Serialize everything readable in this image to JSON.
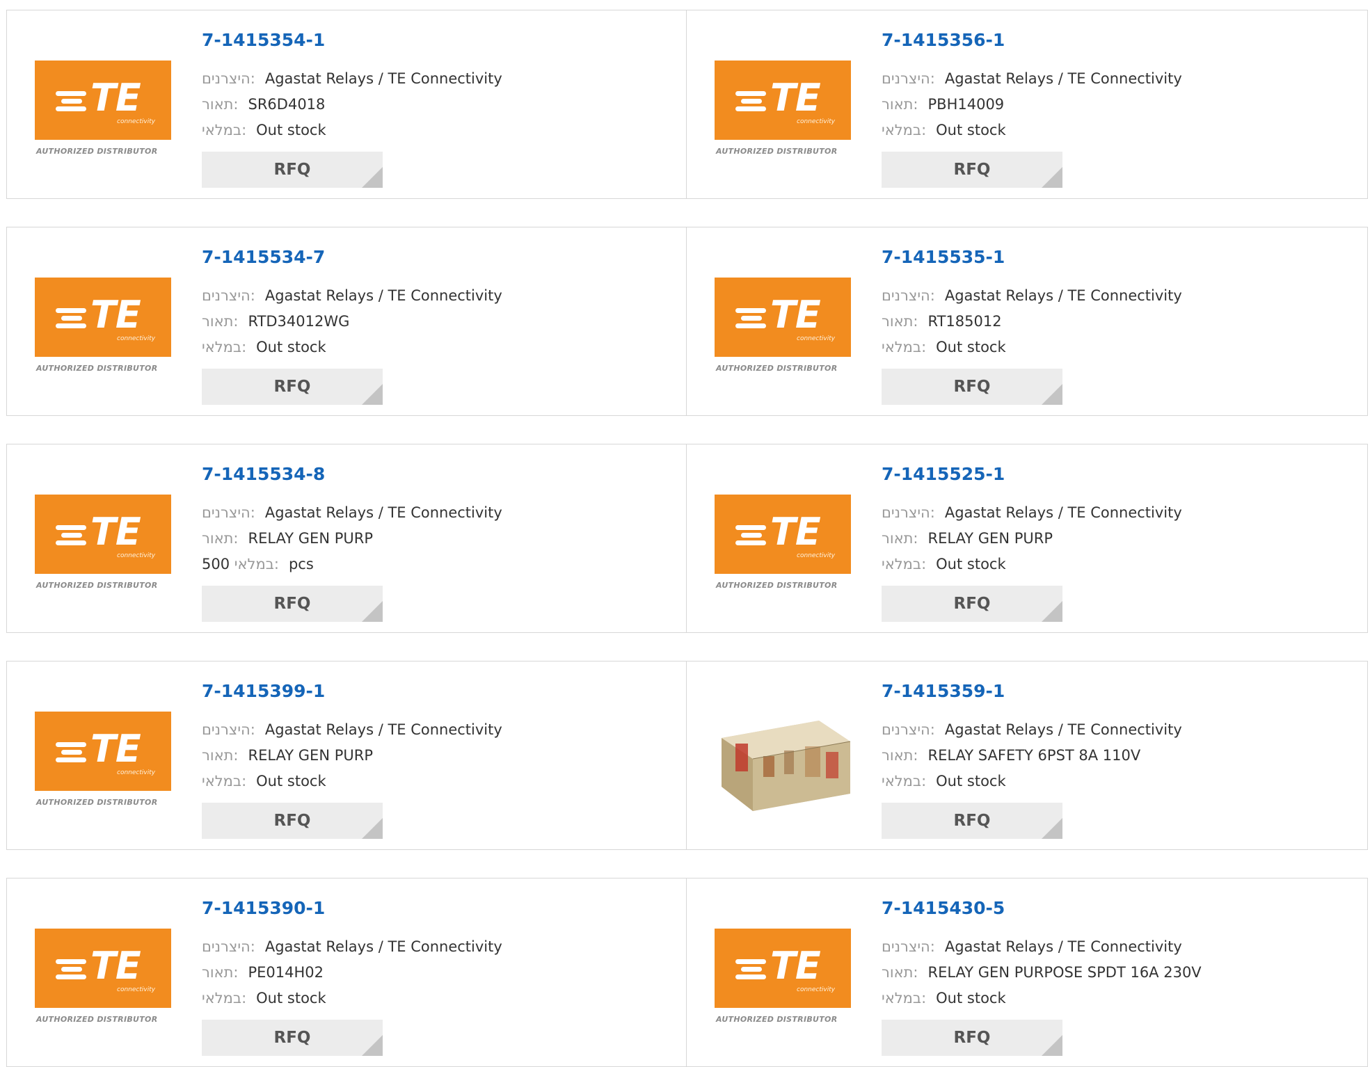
{
  "labels": {
    "manufacturer": "היצרנים:",
    "description": "תאור:",
    "stock": "במלאי:",
    "rfq": "RFQ",
    "logo_brand": "TE",
    "logo_sub": "connectivity",
    "logo_tagline": "AUTHORIZED DISTRIBUTOR"
  },
  "colors": {
    "part_link": "#1565b8",
    "logo_orange": "#f28c1f",
    "rfq_bg": "#ececec"
  },
  "products": [
    {
      "part": "7-1415354-1",
      "manufacturer": "Agastat Relays / TE Connectivity",
      "description": "SR6D4018",
      "stock": "Out stock",
      "image": "te-logo"
    },
    {
      "part": "7-1415356-1",
      "manufacturer": "Agastat Relays / TE Connectivity",
      "description": "PBH14009",
      "stock": "Out stock",
      "image": "te-logo"
    },
    {
      "part": "7-1415534-7",
      "manufacturer": "Agastat Relays / TE Connectivity",
      "description": "RTD34012WG",
      "stock": "Out stock",
      "image": "te-logo"
    },
    {
      "part": "7-1415535-1",
      "manufacturer": "Agastat Relays / TE Connectivity",
      "description": "RT185012",
      "stock": "Out stock",
      "image": "te-logo"
    },
    {
      "part": "7-1415534-8",
      "manufacturer": "Agastat Relays / TE Connectivity",
      "description": "RELAY GEN PURP",
      "stock_qty": "500",
      "stock_unit": "pcs",
      "image": "te-logo"
    },
    {
      "part": "7-1415525-1",
      "manufacturer": "Agastat Relays / TE Connectivity",
      "description": "RELAY GEN PURP",
      "stock": "Out stock",
      "image": "te-logo"
    },
    {
      "part": "7-1415399-1",
      "manufacturer": "Agastat Relays / TE Connectivity",
      "description": "RELAY GEN PURP",
      "stock": "Out stock",
      "image": "te-logo"
    },
    {
      "part": "7-1415359-1",
      "manufacturer": "Agastat Relays / TE Connectivity",
      "description": "RELAY SAFETY 6PST 8A 110V",
      "stock": "Out stock",
      "image": "relay-photo"
    },
    {
      "part": "7-1415390-1",
      "manufacturer": "Agastat Relays / TE Connectivity",
      "description": "PE014H02",
      "stock": "Out stock",
      "image": "te-logo"
    },
    {
      "part": "7-1415430-5",
      "manufacturer": "Agastat Relays / TE Connectivity",
      "description": "RELAY GEN PURPOSE SPDT 16A 230V",
      "stock": "Out stock",
      "image": "te-logo"
    }
  ]
}
